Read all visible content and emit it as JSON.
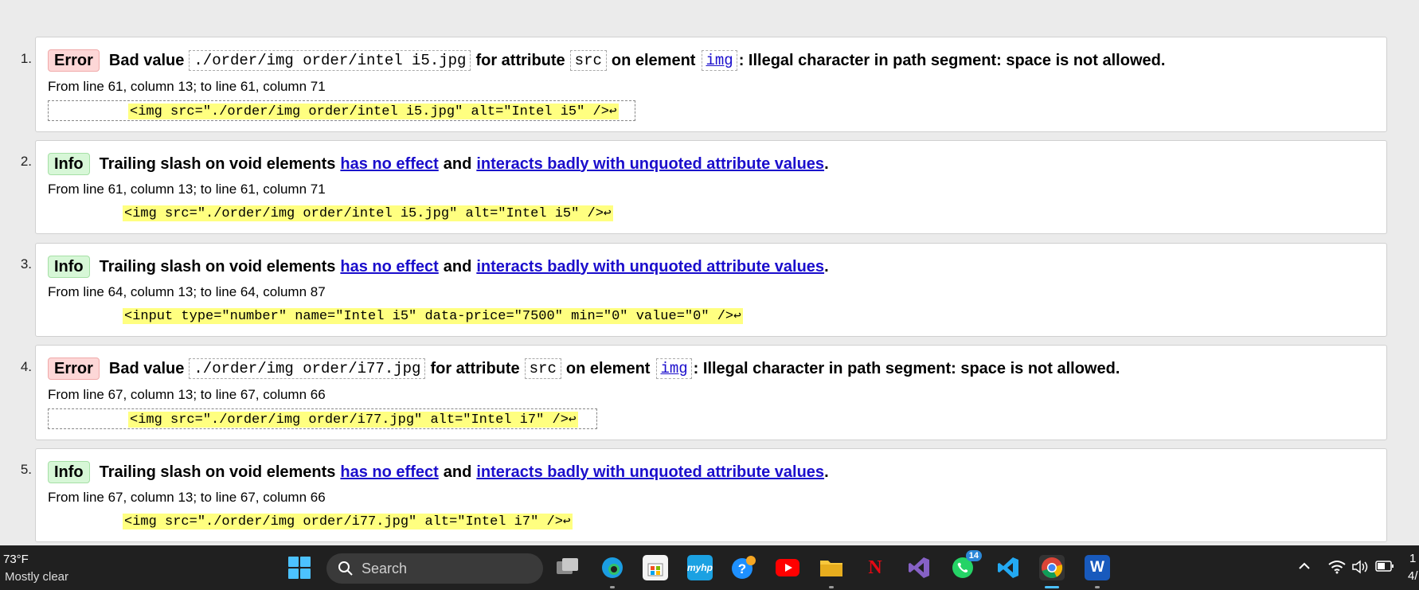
{
  "messages": [
    {
      "number": "1.",
      "type_label": "Error",
      "prefix": "Bad value",
      "value": "./order/img order/intel i5.jpg",
      "mid1": "for attribute",
      "attr": "src",
      "mid2": "on element",
      "element": "img",
      "suffix": ": Illegal character in path segment: space is not allowed.",
      "location": "From line 61, column 13; to line 61, column 71",
      "extract": "<img src=\"./order/img order/intel i5.jpg\" alt=\"Intel i5\" />"
    },
    {
      "number": "2.",
      "type_label": "Info",
      "text": "Trailing slash on void elements",
      "link1": "has no effect",
      "and": "and",
      "link2": "interacts badly with unquoted attribute values",
      "period": ".",
      "location": "From line 61, column 13; to line 61, column 71",
      "extract": "<img src=\"./order/img order/intel i5.jpg\" alt=\"Intel i5\" />"
    },
    {
      "number": "3.",
      "type_label": "Info",
      "text": "Trailing slash on void elements",
      "link1": "has no effect",
      "and": "and",
      "link2": "interacts badly with unquoted attribute values",
      "period": ".",
      "location": "From line 64, column 13; to line 64, column 87",
      "extract": "<input type=\"number\" name=\"Intel i5\" data-price=\"7500\" min=\"0\" value=\"0\" />"
    },
    {
      "number": "4.",
      "type_label": "Error",
      "prefix": "Bad value",
      "value": "./order/img order/i77.jpg",
      "mid1": "for attribute",
      "attr": "src",
      "mid2": "on element",
      "element": "img",
      "suffix": ": Illegal character in path segment: space is not allowed.",
      "location": "From line 67, column 13; to line 67, column 66",
      "extract": "<img src=\"./order/img order/i77.jpg\" alt=\"Intel i7\" />"
    },
    {
      "number": "5.",
      "type_label": "Info",
      "text": "Trailing slash on void elements",
      "link1": "has no effect",
      "and": "and",
      "link2": "interacts badly with unquoted attribute values",
      "period": ".",
      "location": "From line 67, column 13; to line 67, column 66",
      "extract": "<img src=\"./order/img order/i77.jpg\" alt=\"Intel i7\" />"
    }
  ],
  "return_glyph": "↩",
  "taskbar": {
    "weather_temp": "73°F",
    "weather_text": "Mostly clear",
    "search_label": "Search",
    "whatsapp_badge": "14",
    "tray_clock_fragment": "1",
    "tray_date_fragment": "4/"
  },
  "colors": {
    "error_badge_bg": "#fdd7d7",
    "info_badge_bg": "#d7f7d7",
    "highlight": "#ffff80",
    "link": "#1a0dcc",
    "taskbar_bg": "#202020"
  }
}
